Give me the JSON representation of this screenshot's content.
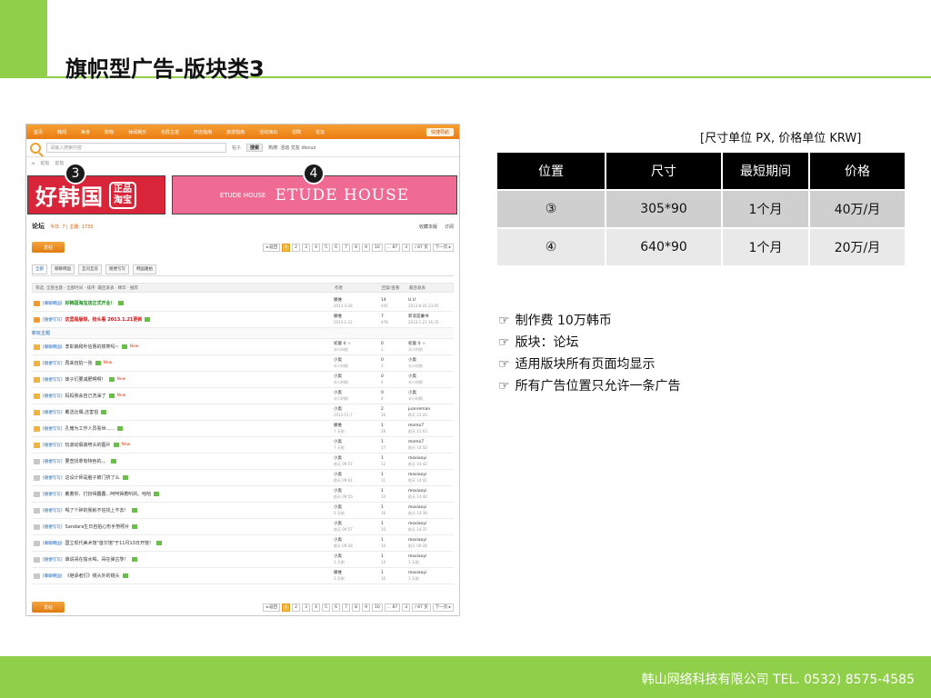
{
  "title": "旗帜型广告-版块类3",
  "unit_note": "[尺寸单位 PX, 价格单位 KRW]",
  "table": {
    "headers": [
      "位置",
      "尺寸",
      "最短期间",
      "价格"
    ],
    "rows": [
      [
        "③",
        "305*90",
        "1个月",
        "40万/月"
      ],
      [
        "④",
        "640*90",
        "1个月",
        "20万/月"
      ]
    ]
  },
  "notes": [
    "制作费 10万韩币",
    "版块：论坛",
    "适用版块所有页面均显示",
    "所有广告位置只允许一条广告"
  ],
  "note_icon": "☞",
  "footer": "韩山网络科技有限公司   TEL. 0532) 8575-4585",
  "colors": {
    "accent": "#8fcf4a",
    "header_bg": "#000000",
    "row1": "#cfcfcf",
    "row2": "#e9e9e9",
    "forum_orange": "#ea7d12",
    "banner3_red": "#d9253a",
    "banner4_pink": "#f06b93"
  },
  "screenshot": {
    "nav": [
      "首页",
      "韩闻",
      "美食",
      "购物",
      "休闲娱乐",
      "名胜古迹",
      "开店指南",
      "旅游指南",
      "活动演出",
      "招聘",
      "论坛"
    ],
    "nav_btn": "快捷导航",
    "search_placeholder": "请输入搜索内容",
    "search_select": "帖子",
    "search_btn": "搜索",
    "hot": "热搜: 活动 交友 discuz",
    "crumb": [
      "论坛",
      "论坛"
    ],
    "marker3": "3",
    "marker4": "4",
    "banner3_text": "好韩国",
    "banner3_seal": "正品淘宝",
    "banner4_mark": "ETUDE HOUSE",
    "banner4_text": "ETUDE HOUSE",
    "forum_title": "论坛",
    "forum_stat": "今日: 7 | 主题: 1733",
    "forum_right": [
      "收藏本版",
      "订阅"
    ],
    "post_btn": "发帖",
    "pager": [
      "◂ 返回",
      "1",
      "2",
      "3",
      "4",
      "5",
      "6",
      "7",
      "8",
      "9",
      "10",
      "... 87",
      "3",
      "/ 87 页",
      "下一页 ▸"
    ],
    "tabs": [
      "全部",
      "聊聊韩国",
      "互问互答",
      "随便写写",
      "韩国趣拍"
    ],
    "filter": "筛选: 全部主题 · 全部时间 · 排序: 最后发表 · 精华 · 推荐",
    "filter_author": "作者",
    "filter_reply": "回复/查看",
    "filter_last": "最后发表",
    "subhead": "新玩主题",
    "rows": [
      {
        "cat": "[聊聊韩国]",
        "title": "好韩国淘宝店正式开业！",
        "style": "hl-green",
        "icon": "pin",
        "author": "滕维",
        "adate": "2013-3-28",
        "r": "14",
        "v": "445",
        "last": "U.U",
        "ldate": "2013-8-16 23:45"
      },
      {
        "cat": "[随便写写]",
        "title": "这里是版规，抢头看 2013.1.21更新",
        "style": "hl-red",
        "icon": "pin",
        "author": "滕维",
        "adate": "2013-1-21",
        "r": "7",
        "v": "478",
        "last": "新浪是薯书",
        "ldate": "2013-1-21 16:35"
      },
      {
        "cat": "[聊聊韩国]",
        "title": "李彰镐和朴信惠的搞笑吗~",
        "style": "",
        "icon": "",
        "new": "New",
        "author": "初璇 ♀ ☆",
        "adate": "半小时前",
        "r": "0",
        "v": "1",
        "last": "初璇 ♀ ☆",
        "ldate": "半小时前"
      },
      {
        "cat": "[随便写写]",
        "title": "再来自拍一张",
        "style": "",
        "icon": "",
        "new": "New",
        "author": "小奥",
        "adate": "半小时前",
        "r": "0",
        "v": "3",
        "last": "小奥",
        "ldate": "半小时前"
      },
      {
        "cat": "[随便写写]",
        "title": "妹子们要减肥啊啊！",
        "style": "",
        "icon": "",
        "new": "New",
        "author": "小奥",
        "adate": "半小时前",
        "r": "0",
        "v": "4",
        "last": "小奥",
        "ldate": "半小时前"
      },
      {
        "cat": "[随便写写]",
        "title": "妈妈我会自己洗澡了",
        "style": "",
        "icon": "",
        "new": "New",
        "author": "小奥",
        "adate": "半小时前",
        "r": "0",
        "v": "4",
        "last": "小奥",
        "ldate": "半小时前"
      },
      {
        "cat": "[随便写写]",
        "title": "戴洁比偶,还害怕",
        "style": "",
        "icon": "",
        "author": "小奥",
        "adate": "2013-11-7",
        "r": "2",
        "v": "16",
        "last": "juanreman",
        "ldate": "昨天 23:26"
      },
      {
        "cat": "[随便写写]",
        "title": "孔俺为工作人员看世......",
        "style": "",
        "icon": "",
        "author": "滕维",
        "adate": "7 天前",
        "r": "1",
        "v": "28",
        "last": "momo7",
        "ldate": "前天 15:03"
      },
      {
        "cat": "[随便写写]",
        "title": "玩滚动假装喷头的图片",
        "style": "",
        "icon": "",
        "new": "New",
        "author": "小奥",
        "adate": "7 天前",
        "r": "1",
        "v": "17",
        "last": "momo7",
        "ldate": "前天 14:58"
      },
      {
        "cat": "[随便写写]",
        "title": "要查找拿有特色的。。",
        "style": "",
        "icon": "gray",
        "author": "小奥",
        "adate": "前天 09:57",
        "r": "1",
        "v": "12",
        "last": "moxiaoyi",
        "ldate": "前天 14:42"
      },
      {
        "cat": "[随便写写]",
        "title": "这设计师是脑子被门挤了么",
        "style": "",
        "icon": "gray",
        "author": "小奥",
        "adate": "前天 09:41",
        "r": "1",
        "v": "11",
        "last": "moxiaoyi",
        "ldate": "前天 14:41"
      },
      {
        "cat": "[随便写写]",
        "title": "戴着你、打扮得蠢蠢...呵呵得着听的。哈哈",
        "style": "",
        "icon": "gray",
        "author": "小奥",
        "adate": "前天 09:55",
        "r": "1",
        "v": "10",
        "last": "moxiaoyi",
        "ldate": "前天 14:40"
      },
      {
        "cat": "[随便写写]",
        "title": "喝了个碎的我就不信找上不去！",
        "style": "",
        "icon": "gray",
        "author": "小奥",
        "adate": "3 天前",
        "r": "1",
        "v": "16",
        "last": "moxiaoyi",
        "ldate": "前天 14:38"
      },
      {
        "cat": "[随便写写]",
        "title": "Sandara生日自拍心形手势照片",
        "style": "",
        "icon": "gray",
        "author": "小奥",
        "adate": "前天 09:57",
        "r": "1",
        "v": "10",
        "last": "moxiaoyi",
        "ldate": "前天 14:37"
      },
      {
        "cat": "[聊聊韩国]",
        "title": "国立现代美术馆\"首尔馆\"于11月13日开馆！",
        "style": "",
        "icon": "gray",
        "author": "小奥",
        "adate": "前天 09:28",
        "r": "1",
        "v": "10",
        "last": "moxiaoyi",
        "ldate": "前天 09:28"
      },
      {
        "cat": "[随便写写]",
        "title": "谁说哥在偷水喝，哥在弹古筝！",
        "style": "",
        "icon": "gray",
        "author": "小奥",
        "adate": "3 天前",
        "r": "1",
        "v": "14",
        "last": "moxiaoyi",
        "ldate": "3 天前"
      },
      {
        "cat": "[聊聊韩国]",
        "title": "《继承者们》镜头外的镜头",
        "style": "",
        "icon": "gray",
        "author": "滕维",
        "adate": "3 天前",
        "r": "1",
        "v": "10",
        "last": "moxiaoyi",
        "ldate": "3 天前"
      }
    ]
  }
}
